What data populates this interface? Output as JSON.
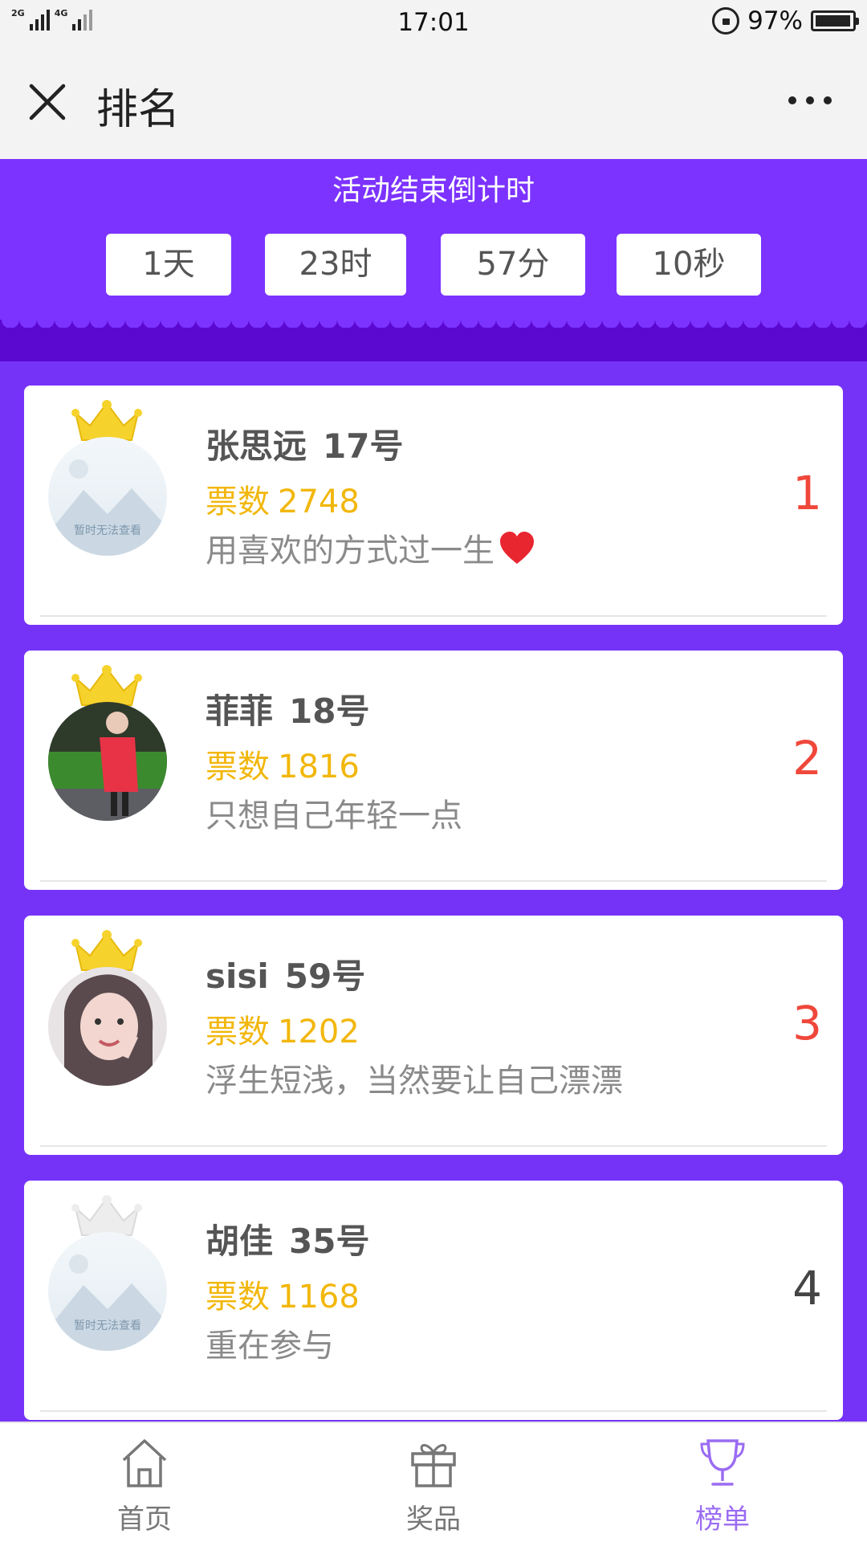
{
  "status_bar": {
    "network_labels": [
      "2G",
      "4G"
    ],
    "time": "17:01",
    "battery_percent": "97%",
    "battery_level": 0.97
  },
  "nav": {
    "title": "排名",
    "close_icon": "close-icon",
    "more_icon": "more-icon"
  },
  "countdown": {
    "title": "活动结束倒计时",
    "days": "1天",
    "hours": "23时",
    "minutes": "57分",
    "seconds": "10秒"
  },
  "ranking": [
    {
      "rank": "1",
      "name": "张思远",
      "number": "17号",
      "votes_label": "票数",
      "votes": "2748",
      "slogan": "用喜欢的方式过一生",
      "has_heart": true,
      "avatar": "placeholder",
      "avatar_text": "暂时无法查看",
      "crown": "gold"
    },
    {
      "rank": "2",
      "name": "菲菲",
      "number": "18号",
      "votes_label": "票数",
      "votes": "1816",
      "slogan": "只想自己年轻一点",
      "avatar": "photo",
      "crown": "gold"
    },
    {
      "rank": "3",
      "name": "sisi",
      "number": "59号",
      "votes_label": "票数",
      "votes": "1202",
      "slogan": "浮生短浅，当然要让自己漂漂",
      "avatar": "photo",
      "crown": "gold"
    },
    {
      "rank": "4",
      "name": "胡佳",
      "number": "35号",
      "votes_label": "票数",
      "votes": "1168",
      "slogan": "重在参与",
      "avatar": "placeholder",
      "avatar_text": "暂时无法查看",
      "crown": "gray"
    }
  ],
  "tabs": [
    {
      "label": "首页",
      "icon": "home-icon",
      "active": false
    },
    {
      "label": "奖品",
      "icon": "gift-icon",
      "active": false
    },
    {
      "label": "榜单",
      "icon": "trophy-icon",
      "active": true
    }
  ],
  "colors": {
    "background": "#7633F8",
    "header": "#7C33FF",
    "votes": "#F2B70C",
    "rank_top": "#F0473B",
    "tab_active": "#9B6CF2"
  }
}
